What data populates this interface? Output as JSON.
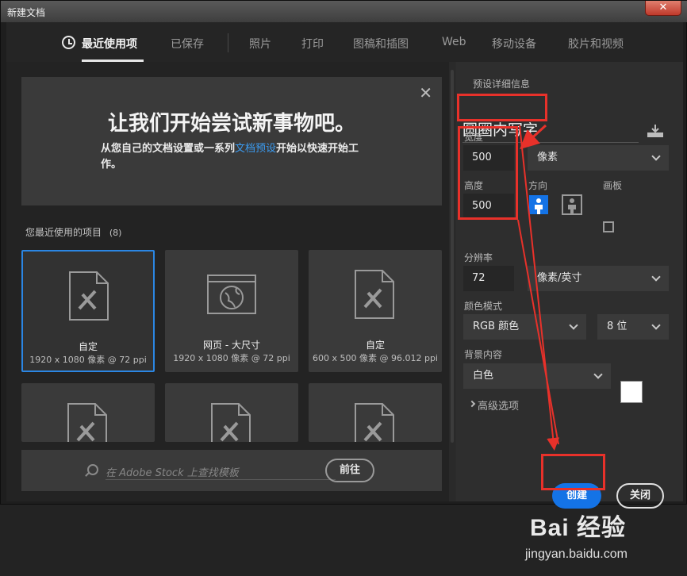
{
  "window": {
    "title": "新建文档",
    "close_glyph": "✕"
  },
  "tabs": [
    {
      "label": "最近使用项",
      "active": true
    },
    {
      "label": "已保存"
    },
    {
      "label": "照片"
    },
    {
      "label": "打印"
    },
    {
      "label": "图稿和插图"
    },
    {
      "label": "Web"
    },
    {
      "label": "移动设备"
    },
    {
      "label": "胶片和视频"
    }
  ],
  "welcome": {
    "title": "让我们开始尝试新事物吧。",
    "body_pre": "从您自己的文档设置或一系列",
    "body_link": "文档预设",
    "body_post": "开始以快速开始工作。",
    "close_glyph": "✕"
  },
  "recent": {
    "label": "您最近使用的项目",
    "count": "(8)",
    "cards": [
      {
        "title": "自定",
        "sub": "1920 x 1080 像素 @ 72 ppi",
        "icon": "document-ruler-icon",
        "selected": true
      },
      {
        "title": "网页 - 大尺寸",
        "sub": "1920 x 1080 像素 @ 72 ppi",
        "icon": "web-globe-icon"
      },
      {
        "title": "自定",
        "sub": "600 x 500 像素 @ 96.012 ppi",
        "icon": "document-ruler-icon"
      }
    ]
  },
  "search": {
    "placeholder": "在 Adobe Stock 上查找模板",
    "go_label": "前往"
  },
  "preset": {
    "section_label": "预设详细信息",
    "name": "圆圈内写字",
    "width_label": "宽度",
    "width_value": "500",
    "unit": "像素",
    "height_label": "高度",
    "height_value": "500",
    "orientation_label": "方向",
    "artboard_label": "画板",
    "resolution_label": "分辨率",
    "resolution_value": "72",
    "resolution_unit": "像素/英寸",
    "color_mode_label": "颜色模式",
    "color_mode": "RGB 颜色",
    "bit_depth": "8 位",
    "background_label": "背景内容",
    "background": "白色",
    "background_color": "#ffffff",
    "advanced_label": "高级选项"
  },
  "actions": {
    "create": "创建",
    "close": "关闭"
  },
  "annotation_color": "#e8312a",
  "watermark": {
    "brand": "Bai 经验",
    "url": "jingyan.baidu.com"
  }
}
